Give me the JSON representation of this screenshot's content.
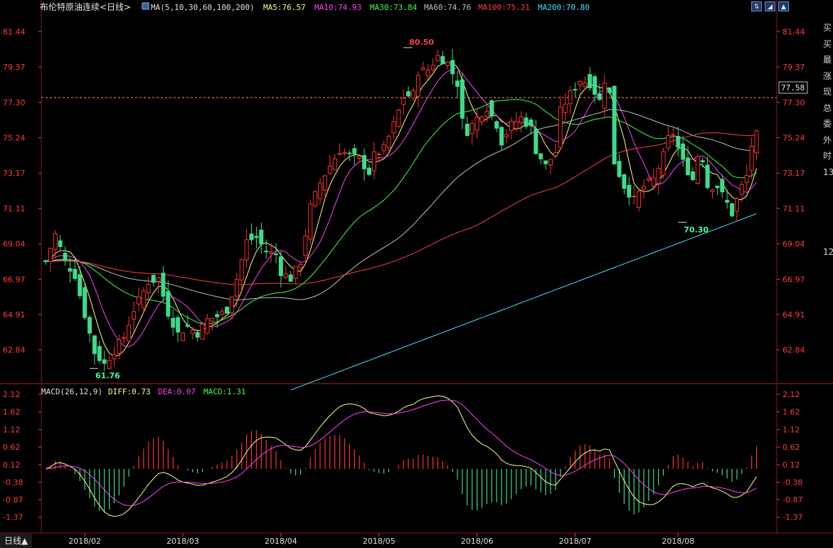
{
  "header": {
    "title": "布伦特原油连续<日线>",
    "ma_spec": "MA(5,10,30,60,100,200)",
    "ma_values": [
      {
        "label": "MA5:76.57",
        "color": "#ffff80"
      },
      {
        "label": "MA10:74.93",
        "color": "#ff40ff"
      },
      {
        "label": "MA30:73.84",
        "color": "#40ff40"
      },
      {
        "label": "MA60:74.76",
        "color": "#c0c0c0"
      },
      {
        "label": "MA100:75.21",
        "color": "#ff4040"
      },
      {
        "label": "MA200:70.80",
        "color": "#40e0ff"
      }
    ]
  },
  "window_buttons": [
    "⇅",
    "◢",
    "▲"
  ],
  "period_tab": "日线▲",
  "side_panel_chars": [
    "买",
    "买",
    "最",
    "涨",
    "现",
    "总",
    "委",
    "外",
    "时",
    "13",
    "",
    "",
    "",
    "",
    "12"
  ],
  "colors": {
    "up": "#ff3030",
    "down": "#3cdc8c",
    "grid": "#8b1a1a",
    "axis_text": "#ff3c3c"
  },
  "chart_data": [
    {
      "type": "candlestick",
      "y_ticks": [
        "81.44",
        "79.37",
        "77.30",
        "75.24",
        "73.17",
        "71.11",
        "69.04",
        "66.97",
        "64.91",
        "62.84"
      ],
      "ylim": [
        61.0,
        82.2
      ],
      "x_ticks": [
        {
          "label": "2018/02",
          "index": 8
        },
        {
          "label": "2018/03",
          "index": 28
        },
        {
          "label": "2018/04",
          "index": 48
        },
        {
          "label": "2018/05",
          "index": 68
        },
        {
          "label": "2018/06",
          "index": 88
        },
        {
          "label": "2018/07",
          "index": 108
        },
        {
          "label": "2018/08",
          "index": 129
        }
      ],
      "n_bars": 146,
      "anchors": [
        [
          0,
          68.0
        ],
        [
          2,
          69.6
        ],
        [
          4,
          68.0
        ],
        [
          6,
          67.2
        ],
        [
          8,
          64.9
        ],
        [
          10,
          62.7
        ],
        [
          12,
          62.0
        ],
        [
          14,
          62.8
        ],
        [
          16,
          63.6
        ],
        [
          18,
          65.2
        ],
        [
          21,
          66.8
        ],
        [
          23,
          67.0
        ],
        [
          25,
          65.0
        ],
        [
          27,
          63.8
        ],
        [
          29,
          64.2
        ],
        [
          31,
          63.8
        ],
        [
          33,
          64.6
        ],
        [
          35,
          64.8
        ],
        [
          37,
          65.2
        ],
        [
          39,
          67.0
        ],
        [
          41,
          69.2
        ],
        [
          43,
          69.4
        ],
        [
          45,
          68.6
        ],
        [
          47,
          68.4
        ],
        [
          48,
          67.4
        ],
        [
          50,
          67.0
        ],
        [
          52,
          68.0
        ],
        [
          54,
          71.2
        ],
        [
          56,
          72.6
        ],
        [
          58,
          73.6
        ],
        [
          60,
          74.5
        ],
        [
          62,
          74.2
        ],
        [
          64,
          74.0
        ],
        [
          66,
          73.2
        ],
        [
          67,
          74.2
        ],
        [
          69,
          74.6
        ],
        [
          71,
          76.0
        ],
        [
          73,
          77.6
        ],
        [
          75,
          77.8
        ],
        [
          76,
          79.1
        ],
        [
          78,
          79.2
        ],
        [
          80,
          80.0
        ],
        [
          82,
          79.6
        ],
        [
          84,
          78.4
        ],
        [
          85,
          76.2
        ],
        [
          86,
          75.6
        ],
        [
          88,
          76.4
        ],
        [
          90,
          77.0
        ],
        [
          92,
          76.0
        ],
        [
          93,
          75.0
        ],
        [
          95,
          76.0
        ],
        [
          97,
          76.4
        ],
        [
          99,
          75.8
        ],
        [
          100,
          74.5
        ],
        [
          102,
          73.6
        ],
        [
          104,
          74.4
        ],
        [
          105,
          76.8
        ],
        [
          107,
          77.8
        ],
        [
          109,
          78.6
        ],
        [
          111,
          78.4
        ],
        [
          113,
          77.4
        ],
        [
          114,
          78.6
        ],
        [
          115,
          77.8
        ],
        [
          116,
          73.8
        ],
        [
          118,
          72.4
        ],
        [
          120,
          71.6
        ],
        [
          122,
          72.4
        ],
        [
          124,
          72.8
        ],
        [
          126,
          74.2
        ],
        [
          127,
          75.2
        ],
        [
          128,
          75.5
        ],
        [
          130,
          73.8
        ],
        [
          132,
          72.8
        ],
        [
          133,
          74.2
        ],
        [
          134,
          74.0
        ],
        [
          135,
          72.4
        ],
        [
          137,
          72.4
        ],
        [
          139,
          71.4
        ],
        [
          140,
          70.8
        ],
        [
          141,
          71.6
        ],
        [
          142,
          72.4
        ],
        [
          143,
          73.0
        ],
        [
          144,
          74.8
        ],
        [
          145,
          75.4
        ],
        [
          146,
          76.2
        ],
        [
          147,
          77.6
        ]
      ],
      "ma_lines": [
        {
          "name": "MA5",
          "color": "#ffff80",
          "lag": 2
        },
        {
          "name": "MA10",
          "color": "#ff40ff",
          "lag": 4
        },
        {
          "name": "MA30",
          "color": "#40ff40",
          "lag": 12
        },
        {
          "name": "MA60",
          "color": "#c0c0c0",
          "lag": 24
        },
        {
          "name": "MA100",
          "color": "#ff4040",
          "lag": 40
        },
        {
          "name": "MA200",
          "color": "#40e0ff",
          "start_index": 50,
          "start_value": 60.5,
          "end_value": 70.8
        }
      ],
      "last_price": "77.58",
      "annotations": [
        {
          "text": "80.50",
          "index": 73,
          "value": 80.5,
          "color": "#ff4040"
        },
        {
          "text": "61.76",
          "index": 9,
          "value": 61.76,
          "color": "#40ffa0"
        },
        {
          "text": "70.30",
          "index": 129,
          "value": 70.3,
          "color": "#40ffa0"
        }
      ]
    },
    {
      "type": "bar",
      "title": "MACD(26,12,9)",
      "values_text": [
        {
          "label": "DIFF:0.73",
          "color": "#ffff80"
        },
        {
          "label": "DEA:0.07",
          "color": "#ff40ff"
        },
        {
          "label": "MACD:1.31",
          "color": "#40ff40"
        }
      ],
      "y_ticks": [
        "2.12",
        "1.62",
        "1.12",
        "0.62",
        "0.12",
        "-0.38",
        "-0.87",
        "-1.37"
      ],
      "ylim": [
        -1.8,
        2.3
      ]
    }
  ]
}
